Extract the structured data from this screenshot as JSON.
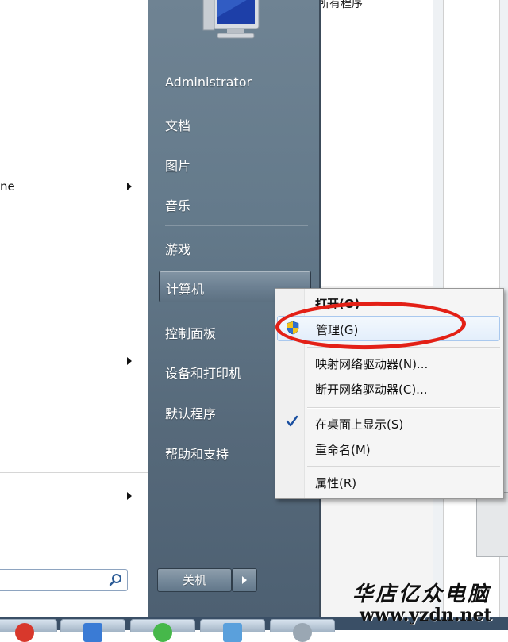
{
  "background_window": {
    "partial_text": "所有程序"
  },
  "left_pane": {
    "items": [
      {
        "label": "ne",
        "has_submenu": true
      },
      {
        "label": "",
        "has_submenu": true
      },
      {
        "label": "",
        "has_submenu": true
      }
    ]
  },
  "start_menu": {
    "user_name": "Administrator",
    "items": {
      "documents": "文档",
      "pictures": "图片",
      "music": "音乐",
      "games": "游戏",
      "computer": "计算机",
      "control_panel": "控制面板",
      "devices_printers": "设备和打印机",
      "default_programs": "默认程序",
      "help_support": "帮助和支持"
    },
    "shutdown_label": "关机"
  },
  "context_menu": {
    "open": "打开(O)",
    "manage": "管理(G)",
    "map_drive": "映射网络驱动器(N)...",
    "disconnect_drive": "断开网络驱动器(C)...",
    "show_on_desktop": "在桌面上显示(S)",
    "rename": "重命名(M)",
    "properties": "属性(R)",
    "show_on_desktop_checked": true
  },
  "annotation": {
    "highlight_color": "#e32016"
  },
  "watermark": {
    "title": "华店亿众电脑",
    "url": "www.yzdn.net"
  }
}
